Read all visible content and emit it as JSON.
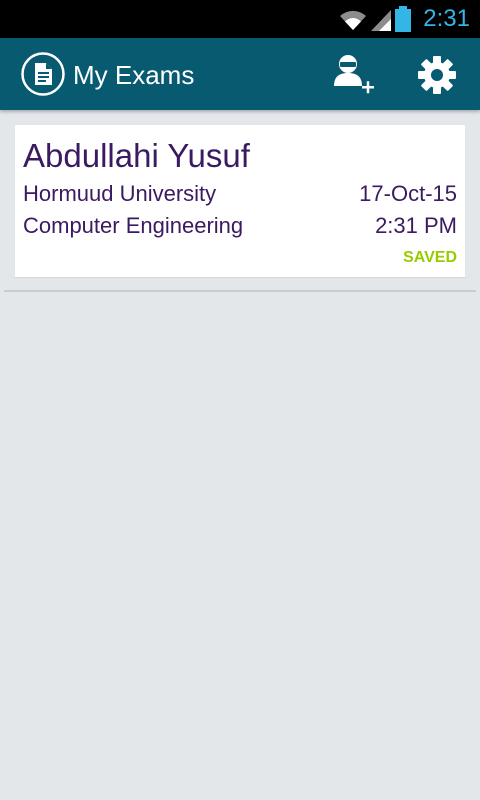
{
  "status_bar": {
    "time": "2:31",
    "icons": [
      "wifi-icon",
      "signal-icon",
      "battery-icon"
    ],
    "time_color": "#33b5e5"
  },
  "app_bar": {
    "title": "My Exams",
    "icon": "document-icon",
    "actions": [
      "add-user-icon",
      "settings-icon"
    ],
    "background": "#075a70"
  },
  "exams": [
    {
      "name": "Abdullahi Yusuf",
      "university": "Hormuud University",
      "date": "17-Oct-15",
      "department": "Computer Engineering",
      "time": "2:31 PM",
      "status": "SAVED"
    }
  ],
  "colors": {
    "text": "#3a1a60",
    "status_saved": "#99cc00",
    "background": "#e3e7ea"
  }
}
